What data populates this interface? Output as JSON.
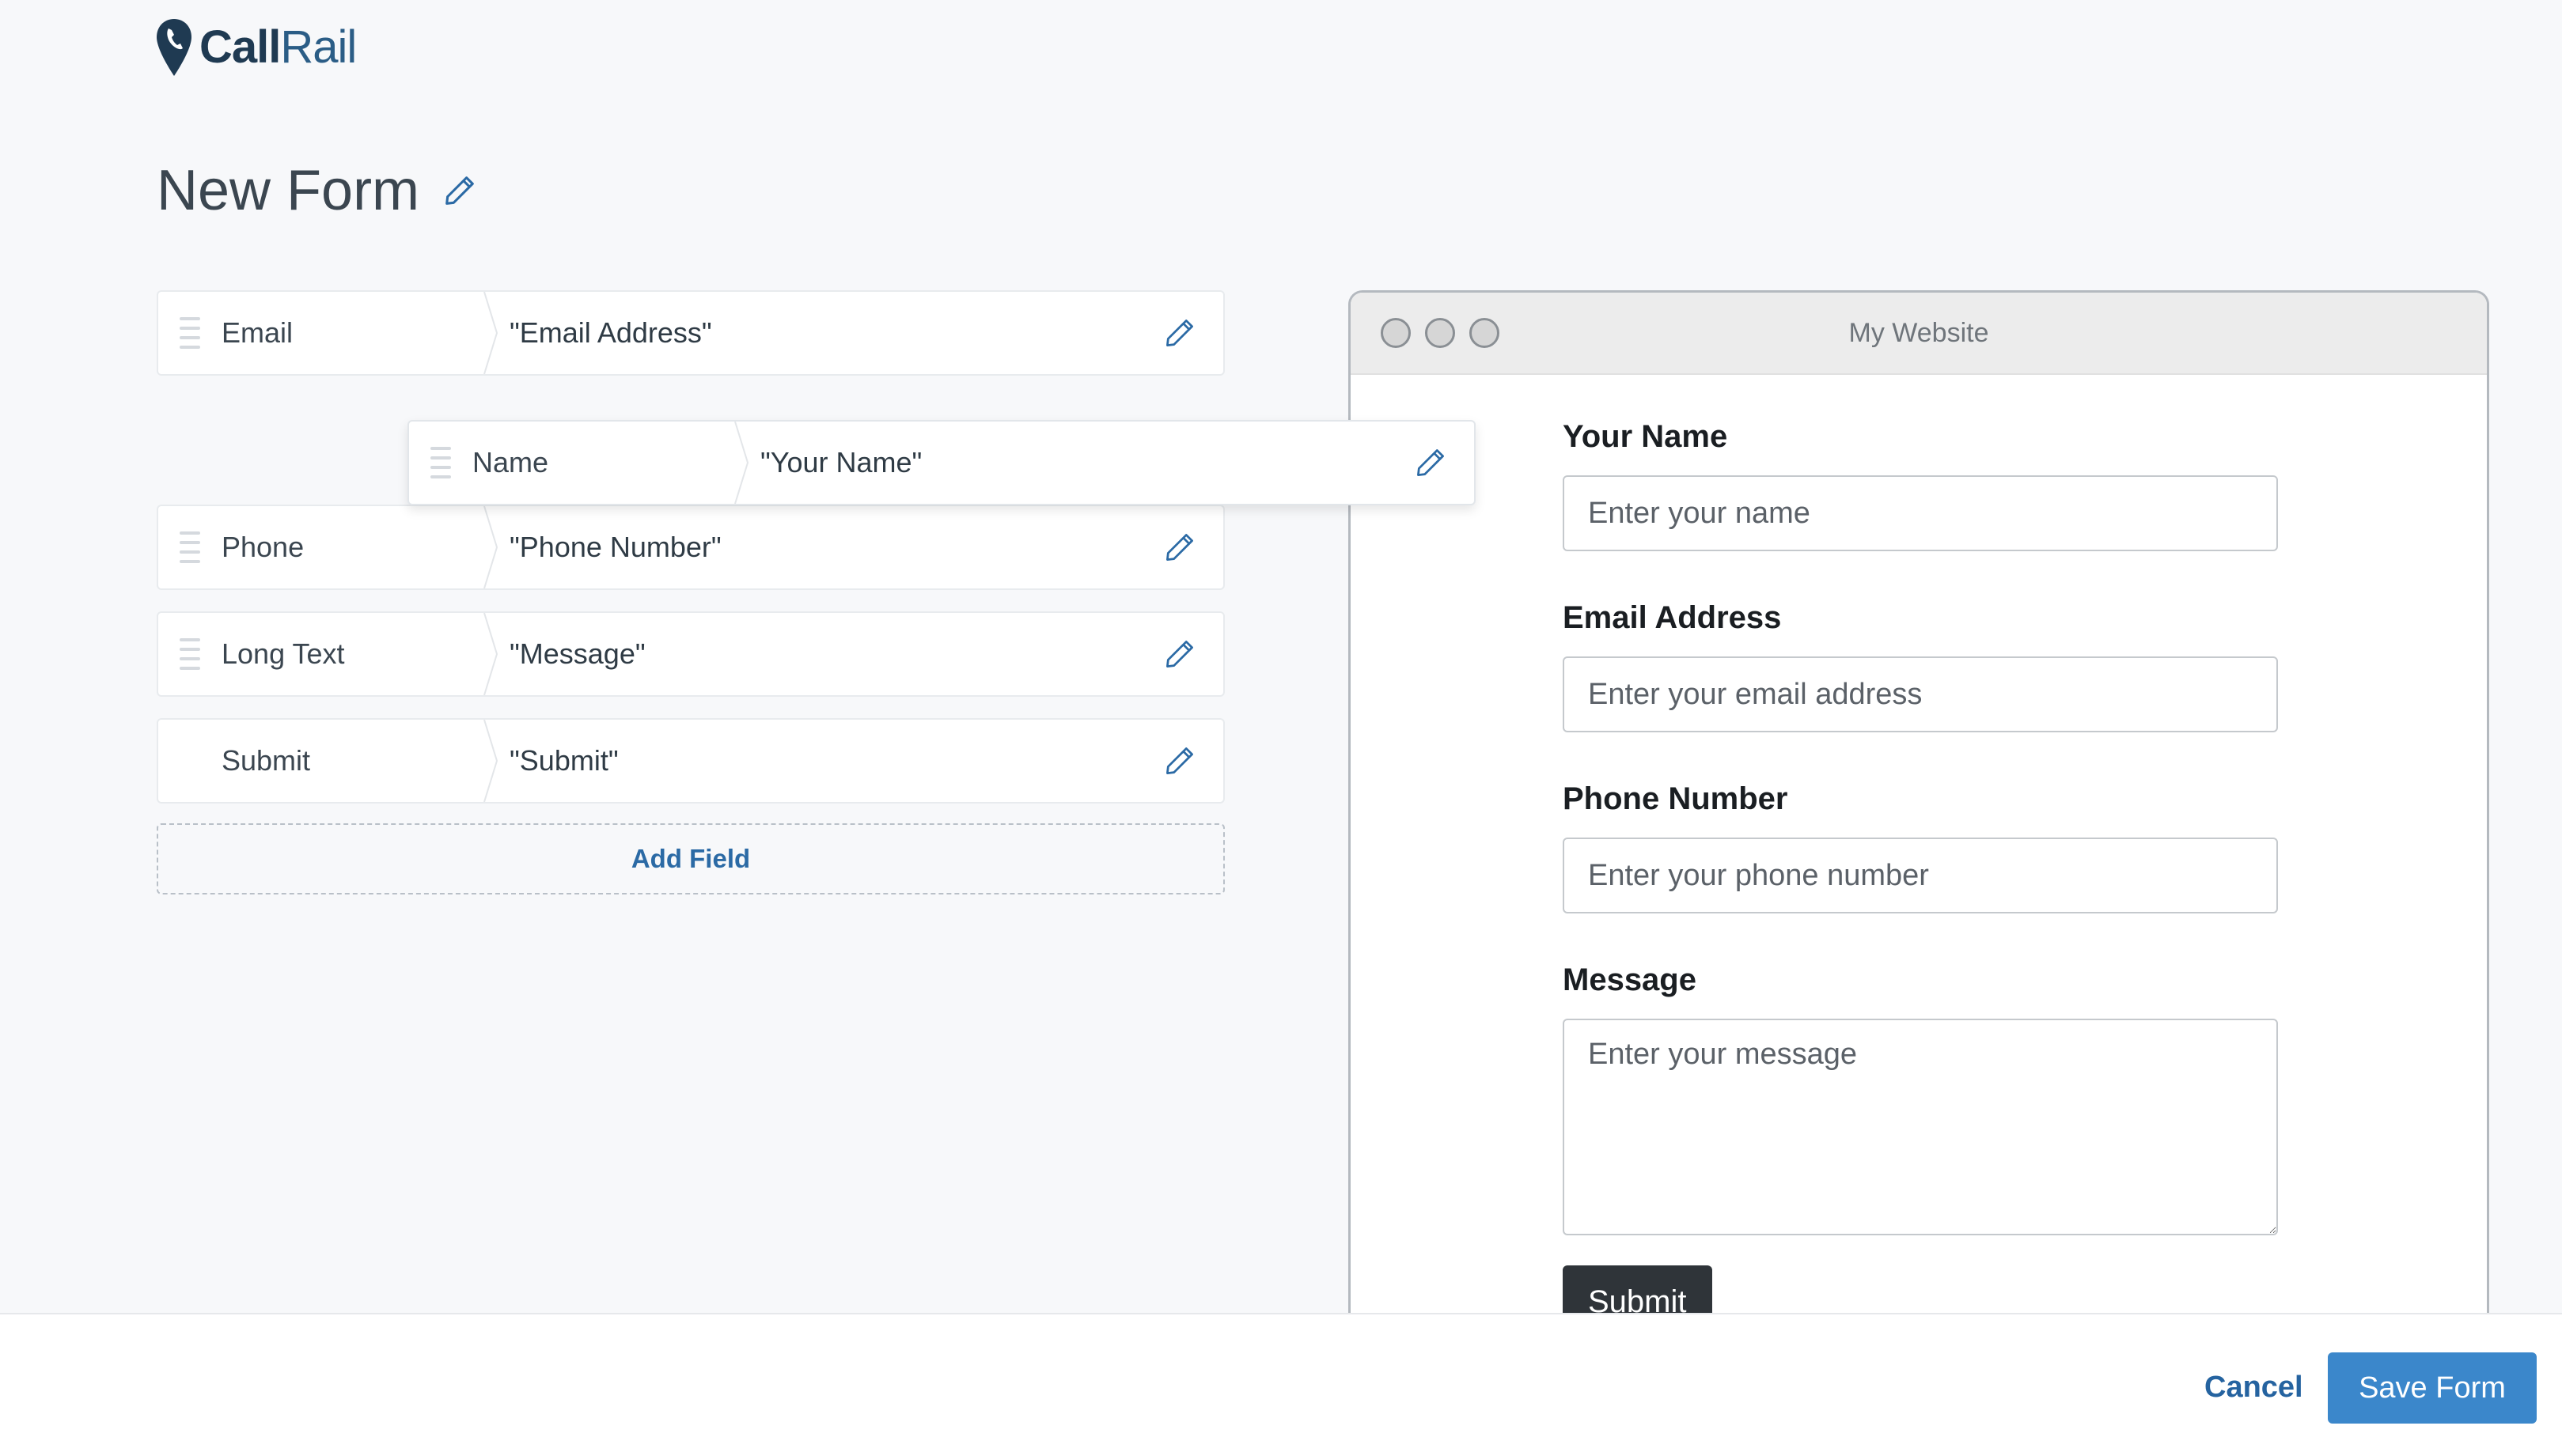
{
  "brand": {
    "name_part1": "Call",
    "name_part2": "Rail",
    "pin_color": "#1f3a52"
  },
  "page": {
    "title": "New Form",
    "title_edit_icon": "pencil-icon"
  },
  "fields": [
    {
      "type": "Email",
      "label": "\"Email Address\"",
      "has_handle": true
    },
    {
      "type": "Name",
      "label": "\"Your Name\"",
      "has_handle": true,
      "dragging": true
    },
    {
      "type": "Phone",
      "label": "\"Phone Number\"",
      "has_handle": true
    },
    {
      "type": "Long Text",
      "label": "\"Message\"",
      "has_handle": true
    },
    {
      "type": "Submit",
      "label": "\"Submit\"",
      "has_handle": false
    }
  ],
  "add_field_label": "Add Field",
  "preview": {
    "window_title": "My Website",
    "name_label": "Your Name",
    "name_placeholder": "Enter your name",
    "email_label": "Email Address",
    "email_placeholder": "Enter your email address",
    "phone_label": "Phone Number",
    "phone_placeholder": "Enter your phone number",
    "message_label": "Message",
    "message_placeholder": "Enter your message",
    "submit_label": "Submit"
  },
  "footer": {
    "cancel_label": "Cancel",
    "save_label": "Save Form"
  },
  "colors": {
    "accent": "#3b87cb",
    "link": "#2563a0",
    "dark_button": "#2f3439"
  }
}
